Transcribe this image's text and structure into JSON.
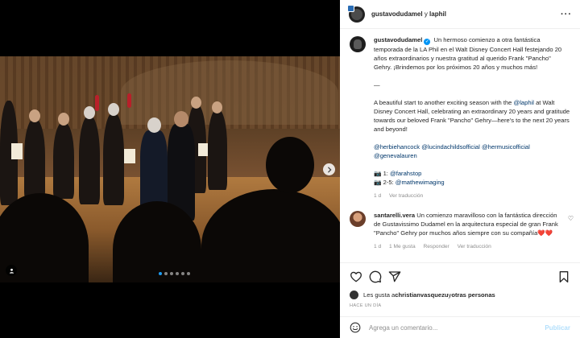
{
  "post": {
    "author": "gustavodudamel",
    "header_conj": "y",
    "collaborator": "laphil",
    "more_icon": "more-horizontal-icon",
    "media_dots": 6,
    "media_active_dot": 0
  },
  "caption": {
    "username": "gustavodudamel",
    "spanish": "Un hermoso comienzo a otra fantástica temporada de la LA Phil en el Walt Disney Concert Hall festejando 20 años extraordinarios y nuestra gratitud al querido Frank \"Pancho\" Gehry. ¡Brindemos por los próximos 20 años y muchos más!",
    "separator": "—",
    "english_before": "A beautiful start to another exciting season with the ",
    "english_mention": "@laphil",
    "english_after": " at Walt Disney Concert Hall, celebrating an extraordinary 20 years and gratitude towards our beloved Frank \"Pancho\" Gehry—here's to the next 20 years and beyond!",
    "mentions": [
      "@herbiehancock",
      "@lucindachildsofficial",
      "@hermusicofficial",
      "@genevalauren"
    ],
    "credit1_prefix": "📷 1: ",
    "credit1": "@farahstop",
    "credit2_prefix": "📷 2-5: ",
    "credit2": "@mathewimaging",
    "time": "1 d",
    "translate": "Ver traducción"
  },
  "comment": {
    "username": "santarelli.vera",
    "text": "Un comienzo maravilloso con la fantástica dirección de Gustavissimo Dudamel en la arquitectura especial de gran Frank \"Pancho\" Gehry por muchos años siempre con su compañía❤️❤️",
    "time": "1 d",
    "likes": "1 Me gusta",
    "reply": "Responder",
    "translate": "Ver traducción"
  },
  "likes": {
    "prefix": "Les gusta a ",
    "user": "christianvasquezu",
    "conj": " y ",
    "others": "otras personas"
  },
  "time_ago": "HACE UN DÍA",
  "add_comment": {
    "placeholder": "Agrega un comentario...",
    "post_label": "Publicar"
  },
  "colors": {
    "link": "#00376b",
    "verified": "#0095f6",
    "post_disabled": "#b2dffc",
    "dot_active": "#1d9bf0"
  }
}
